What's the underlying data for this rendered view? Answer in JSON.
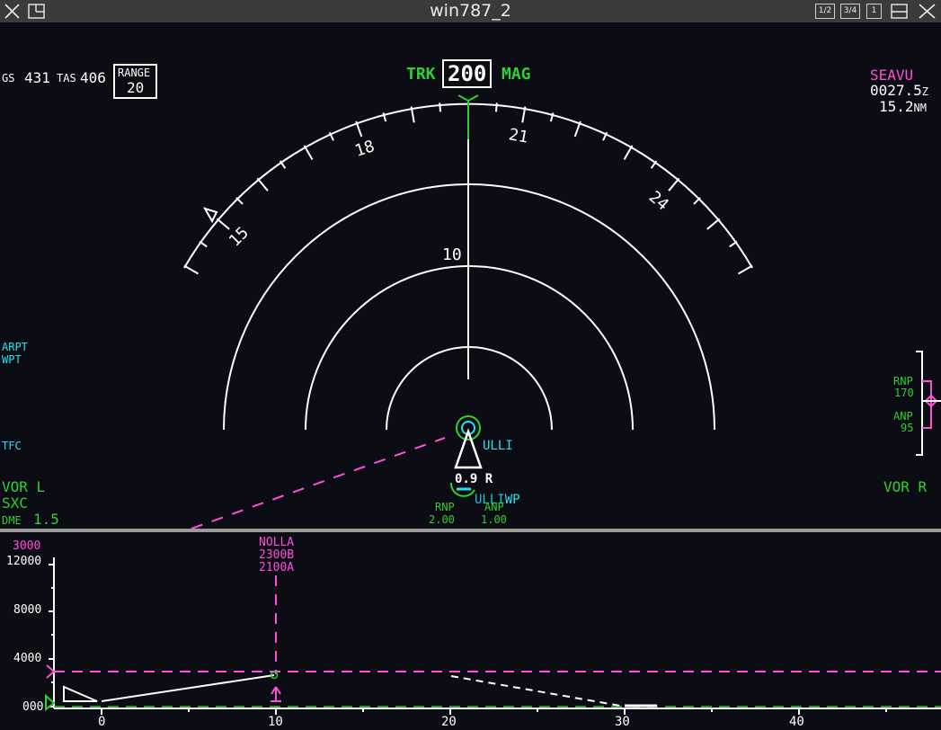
{
  "window": {
    "title": "win787_2",
    "buttons": [
      "1/2",
      "3/4",
      "1"
    ]
  },
  "speeds": {
    "gs_label": "GS",
    "gs_value": "431",
    "tas_label": "TAS",
    "tas_value": "406"
  },
  "range": {
    "label": "RANGE",
    "value": "20"
  },
  "heading": {
    "mode": "TRK",
    "value": "200",
    "ref": "MAG"
  },
  "compass": {
    "labels": [
      "15",
      "18",
      "21",
      "24"
    ],
    "range_ring_label": "10"
  },
  "waypoint_info": {
    "name": "SEAVU",
    "time": "0027.5",
    "time_unit": "Z",
    "distance": "15.2",
    "distance_unit": "NM"
  },
  "left_labels": {
    "arpt": "ARPT",
    "wpt": "WPT",
    "tfc": "TFC"
  },
  "vor_left": {
    "label": "VOR L",
    "ident": "SXC",
    "dme_label": "DME",
    "dme_value": "1.5"
  },
  "vor_right": {
    "label": "VOR R"
  },
  "rnp_anp_right": {
    "rnp_label": "RNP",
    "rnp_value": "170",
    "anp_label": "ANP",
    "anp_value": "95"
  },
  "aircraft": {
    "waypoint": "ULLI",
    "offset": "0.9",
    "offset_side": "R",
    "lower_ident": "ULLI",
    "lower_suffix": "WP"
  },
  "rnp_anp_bottom": {
    "rnp_label": "RNP",
    "rnp_value": "2.00",
    "anp_label": "ANP",
    "anp_value": "1.00"
  },
  "vsd": {
    "selected_alt": "3000",
    "alt_ticks": [
      "12000",
      "8000",
      "4000",
      "000"
    ],
    "dist_ticks": [
      "0",
      "10",
      "20",
      "30",
      "40"
    ],
    "waypoint": {
      "name": "NOLLA",
      "constraint_top": "2300B",
      "constraint_bottom": "2100A"
    }
  },
  "colors": {
    "green": "#2fd02f",
    "cyan": "#27e1f0",
    "magenta": "#ff4fd8",
    "background": "#0b0c14"
  }
}
